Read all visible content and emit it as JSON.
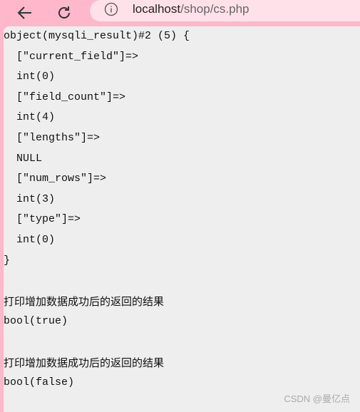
{
  "browser": {
    "url_host": "localhost",
    "url_path": "/shop/cs.php",
    "icons": [
      "back-arrow-icon",
      "reload-icon",
      "info-icon"
    ]
  },
  "output": {
    "lines": [
      "object(mysqli_result)#2 (5) {",
      "  [\"current_field\"]=>",
      "  int(0)",
      "  [\"field_count\"]=>",
      "  int(4)",
      "  [\"lengths\"]=>",
      "  NULL",
      "  [\"num_rows\"]=>",
      "  int(3)",
      "  [\"type\"]=>",
      "  int(0)",
      "}",
      "",
      "打印增加数据成功后的返回的结果",
      "bool(true)",
      "",
      "打印增加数据成功后的返回的结果",
      "bool(false)"
    ]
  },
  "watermark": "CSDN @曼亿点"
}
